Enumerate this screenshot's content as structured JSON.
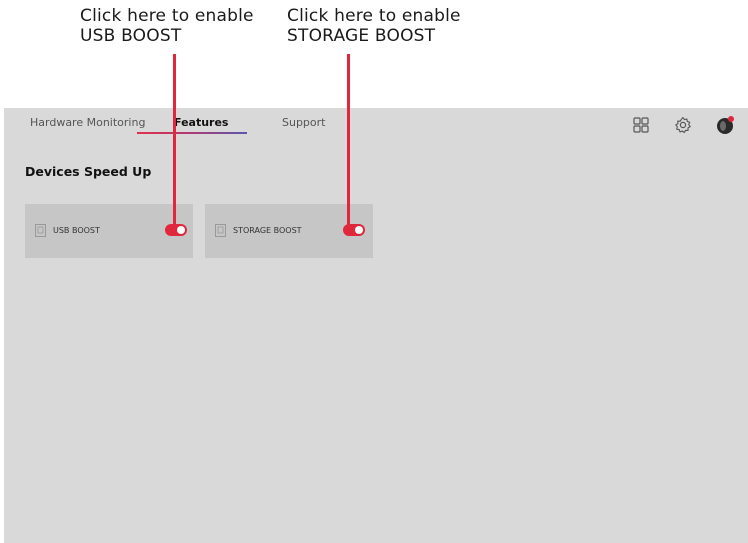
{
  "callouts": {
    "usb": {
      "line1": "Click here to enable",
      "line2": "USB BOOST"
    },
    "storage": {
      "line1": "Click here to enable",
      "line2": "STORAGE BOOST"
    }
  },
  "nav": {
    "tabs": [
      {
        "label": "Hardware Monitoring",
        "active": false
      },
      {
        "label": "Features",
        "active": true
      },
      {
        "label": "Support",
        "active": false
      }
    ],
    "icons": [
      "grid-icon",
      "gear-icon",
      "avatar"
    ]
  },
  "section": {
    "title": "Devices Speed Up"
  },
  "cards": [
    {
      "label": "USB BOOST",
      "toggle_on": true
    },
    {
      "label": "STORAGE BOOST",
      "toggle_on": true
    }
  ],
  "colors": {
    "accent": "#e0283c",
    "panel_bg": "#d9d9d9",
    "card_bg": "#c6c6c6",
    "tab_underline_end": "#5a56b0"
  }
}
